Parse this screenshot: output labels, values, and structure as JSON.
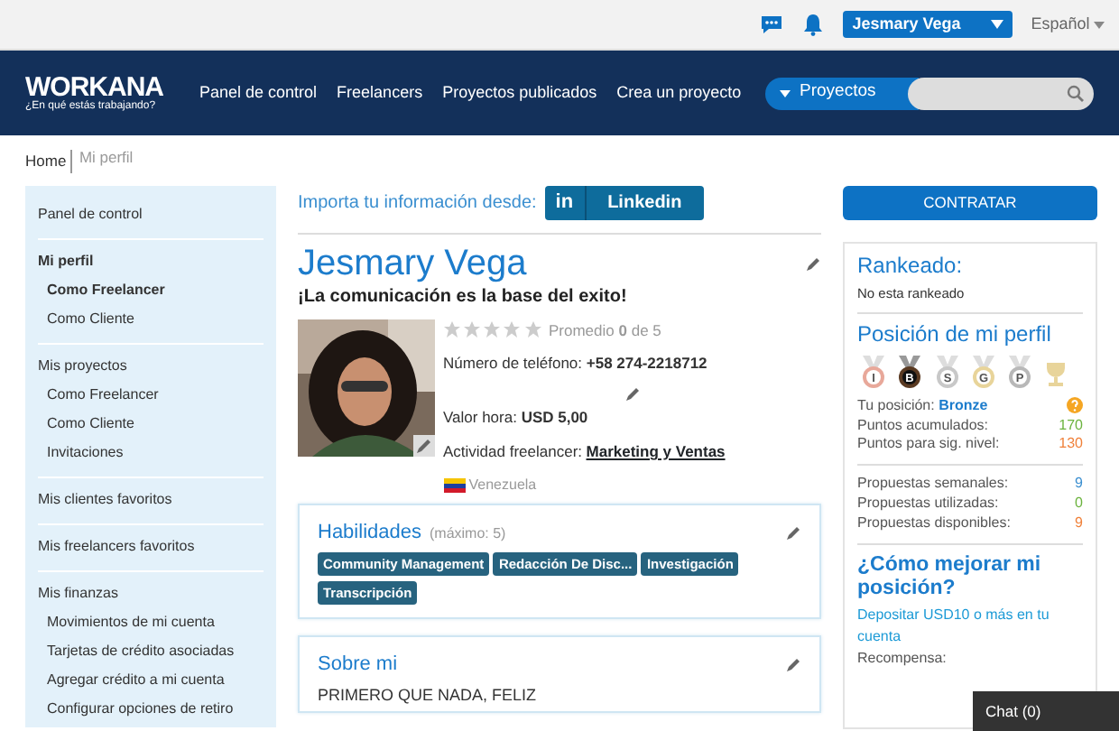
{
  "top_bar": {
    "user_menu": "Jesmary Vega",
    "language": "Español"
  },
  "navbar": {
    "logo": "WORKANA",
    "tagline": "¿En qué estás trabajando?",
    "links": [
      "Panel de control",
      "Freelancers",
      "Proyectos publicados",
      "Crea un proyecto"
    ],
    "search": {
      "scope": "Proyectos"
    }
  },
  "breadcrumb": [
    {
      "label": "Home",
      "selected": false
    },
    {
      "label": "Mi perfil",
      "selected": true
    }
  ],
  "sidebar": {
    "sections": [
      {
        "title": "Panel de control",
        "selected": false
      },
      {
        "title": "Mi perfil",
        "selected": true,
        "children": [
          {
            "label": "Como Freelancer",
            "selected": true
          },
          {
            "label": "Como Cliente",
            "selected": false
          }
        ]
      },
      {
        "title": "Mis proyectos",
        "selected": false,
        "children": [
          {
            "label": "Como Freelancer",
            "selected": false
          },
          {
            "label": "Como Cliente",
            "selected": false
          },
          {
            "label": "Invitaciones",
            "selected": false
          }
        ]
      },
      {
        "title": "Mis clientes favoritos",
        "selected": false
      },
      {
        "title": "Mis freelancers favoritos",
        "selected": false
      },
      {
        "title": "Mis finanzas",
        "selected": false,
        "children": [
          {
            "label": "Movimientos de mi cuenta",
            "selected": false
          },
          {
            "label": "Tarjetas de crédito asociadas",
            "selected": false
          },
          {
            "label": "Agregar crédito a mi cuenta",
            "selected": false
          },
          {
            "label": "Configurar opciones de retiro",
            "selected": false
          }
        ]
      }
    ]
  },
  "profile": {
    "import_label": "Importa tu información desde:",
    "linkedin": {
      "mark": "in",
      "label": "Linkedin"
    },
    "name": "Jesmary Vega",
    "headline": "¡La comunicación es la base del exito!",
    "stars": 0,
    "rating": "Promedio **0** de 5",
    "phone": "Número de teléfono: **+58 274-2218712**",
    "rate": "Valor hora: **USD 5,00**",
    "activity_label": "Actividad freelancer:",
    "activity": "Marketing y Ventas",
    "country": "Venezuela"
  },
  "skills": {
    "title": "Habilidades",
    "hint": "(máximo: 5)",
    "tags": [
      "Community Management",
      "Redacción De Disc...",
      "Investigación",
      "Transcripción"
    ]
  },
  "about": {
    "title": "Sobre mi",
    "text": "PRIMERO QUE NADA, FELIZ"
  },
  "sidebar_right": {
    "hire_button": "CONTRATAR",
    "ranked_title": "Rankeado:",
    "ranked_text": "No esta rankeado",
    "position_title": "Posición de mi perfil",
    "medals": [
      {
        "letter": "I",
        "achieved": false,
        "color": "#e8a89a"
      },
      {
        "letter": "B",
        "achieved": true,
        "color": "#5a3a22"
      },
      {
        "letter": "S",
        "achieved": false,
        "color": "#c8c8c8"
      },
      {
        "letter": "G",
        "achieved": false,
        "color": "#e8d49a"
      },
      {
        "letter": "P",
        "achieved": false,
        "color": "#b8b8b8"
      },
      {
        "achieved": false,
        "color": "#e8d49a"
      }
    ],
    "position": {
      "label": "Tu posición:",
      "value": "Bronze"
    },
    "points": [
      {
        "label": "Puntos acumulados:",
        "value": "170",
        "color": "#6cb33f"
      },
      {
        "label": "Puntos para sig. nivel:",
        "value": "130",
        "color": "#f0813a"
      }
    ],
    "proposals": [
      {
        "label": "Propuestas semanales:",
        "value": "9",
        "color": "#3b8fd0"
      },
      {
        "label": "Propuestas utilizadas:",
        "value": "0",
        "color": "#6cb33f"
      },
      {
        "label": "Propuestas disponibles:",
        "value": "9",
        "color": "#f0813a"
      }
    ],
    "improve_title": "¿Cómo mejorar mi posición?",
    "improve_link": "Depositar USD10 o más en tu cuenta",
    "reward_label": "Recompensa:"
  },
  "chat": {
    "label": "Chat (0)"
  }
}
